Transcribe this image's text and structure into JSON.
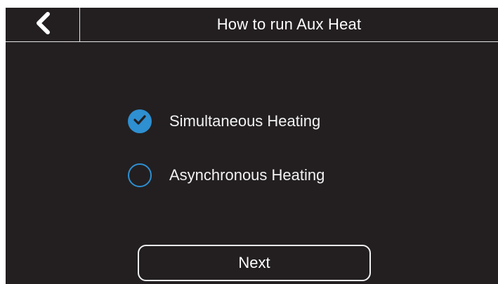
{
  "header": {
    "title": "How to run Aux Heat",
    "back_icon": "chevron-left-icon"
  },
  "options": [
    {
      "label": "Simultaneous Heating",
      "selected": true
    },
    {
      "label": "Asynchronous Heating",
      "selected": false
    }
  ],
  "next_label": "Next",
  "colors": {
    "background": "#231f20",
    "accent": "#2e8fd1",
    "text": "#ffffff"
  }
}
